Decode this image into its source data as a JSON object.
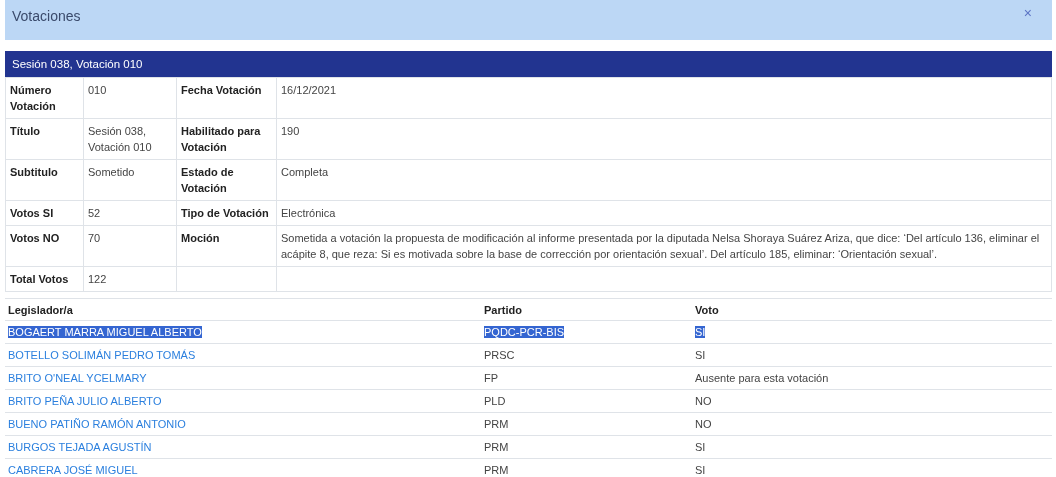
{
  "dialog": {
    "title": "Votaciones",
    "close": "×"
  },
  "panel": {
    "title": "Sesión 038, Votación 010"
  },
  "details": [
    {
      "label": "Número Votación",
      "value": "010",
      "label2": "Fecha Votación",
      "value2": "16/12/2021"
    },
    {
      "label": "Título",
      "value": "Sesión 038, Votación 010",
      "label2": "Habilitado para Votación",
      "value2": "190"
    },
    {
      "label": "Subtitulo",
      "value": "Sometido",
      "label2": "Estado de Votación",
      "value2": "Completa"
    },
    {
      "label": "Votos SI",
      "value": "52",
      "label2": "Tipo de Votación",
      "value2": "Electrónica"
    },
    {
      "label": "Votos NO",
      "value": "70",
      "label2": "Moción",
      "value2": "Sometida a votación la propuesta de modificación al informe presentada por la diputada Nelsa Shoraya Suárez Ariza, que dice: ‘Del artículo 136, eliminar el acápite 8, que reza: Si es motivada sobre la base de corrección por orientación sexual’. Del artículo 185, eliminar: ‘Orientación sexual’."
    },
    {
      "label": "Total Votos",
      "value": "122"
    }
  ],
  "legislators": {
    "columns": [
      "Legislador/a",
      "Partido",
      "Voto"
    ],
    "rows": [
      {
        "name": "BOGAERT MARRA MIGUEL ALBERTO",
        "party": "PQDC-PCR-BIS",
        "vote": "SI",
        "selected": true
      },
      {
        "name": "BOTELLO SOLIMÁN PEDRO TOMÁS",
        "party": "PRSC",
        "vote": "SI",
        "selected": false
      },
      {
        "name": "BRITO O'NEAL YCELMARY",
        "party": "FP",
        "vote": "Ausente para esta votación",
        "selected": false
      },
      {
        "name": "BRITO PEÑA JULIO ALBERTO",
        "party": "PLD",
        "vote": "NO",
        "selected": false
      },
      {
        "name": "BUENO PATIÑO RAMÓN ANTONIO",
        "party": "PRM",
        "vote": "NO",
        "selected": false
      },
      {
        "name": "BURGOS TEJADA AGUSTÍN",
        "party": "PRM",
        "vote": "SI",
        "selected": false
      },
      {
        "name": "CABRERA JOSÉ MIGUEL",
        "party": "PRM",
        "vote": "SI",
        "selected": false
      }
    ]
  }
}
